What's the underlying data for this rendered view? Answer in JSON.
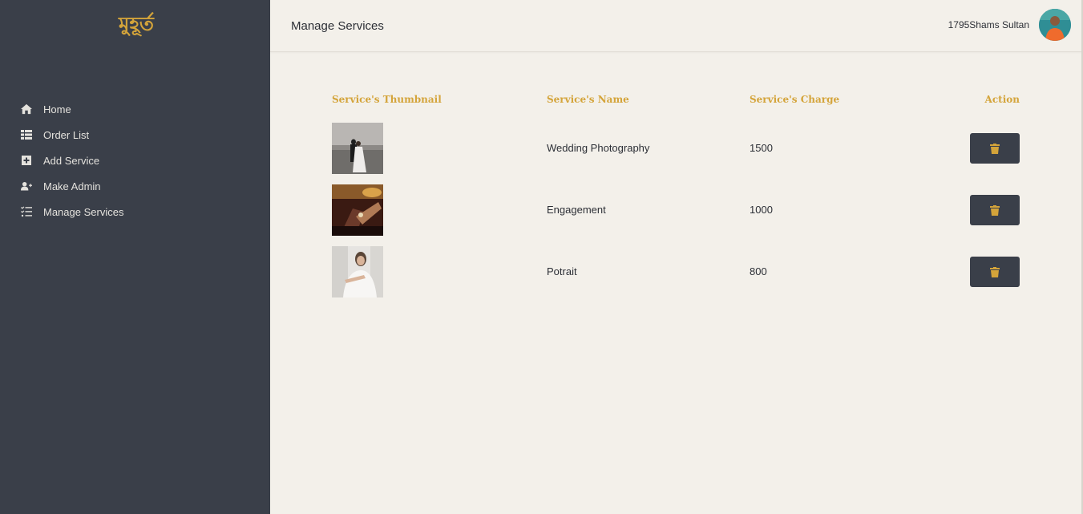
{
  "brand": {
    "logo_text": "মুহূর্ত",
    "accent": "#d4a43a",
    "sidebar_bg": "#3a3f49",
    "page_bg": "#f3f0ea"
  },
  "sidebar": {
    "items": [
      {
        "label": "Home",
        "icon": "home-icon"
      },
      {
        "label": "Order List",
        "icon": "list-icon"
      },
      {
        "label": "Add Service",
        "icon": "plus-square-icon"
      },
      {
        "label": "Make Admin",
        "icon": "user-plus-icon"
      },
      {
        "label": "Manage Services",
        "icon": "tasks-icon"
      }
    ]
  },
  "header": {
    "title": "Manage Services",
    "username": "1795Shams Sultan"
  },
  "table": {
    "columns": [
      "Service's Thumbnail",
      "Service's Name",
      "Service's Charge",
      "Action"
    ],
    "rows": [
      {
        "name": "Wedding Photography",
        "charge": "1500",
        "thumbnail": "wedding-photo"
      },
      {
        "name": "Engagement",
        "charge": "1000",
        "thumbnail": "engagement-photo"
      },
      {
        "name": "Potrait",
        "charge": "800",
        "thumbnail": "portrait-photo"
      }
    ],
    "action_icon": "trash-icon"
  }
}
